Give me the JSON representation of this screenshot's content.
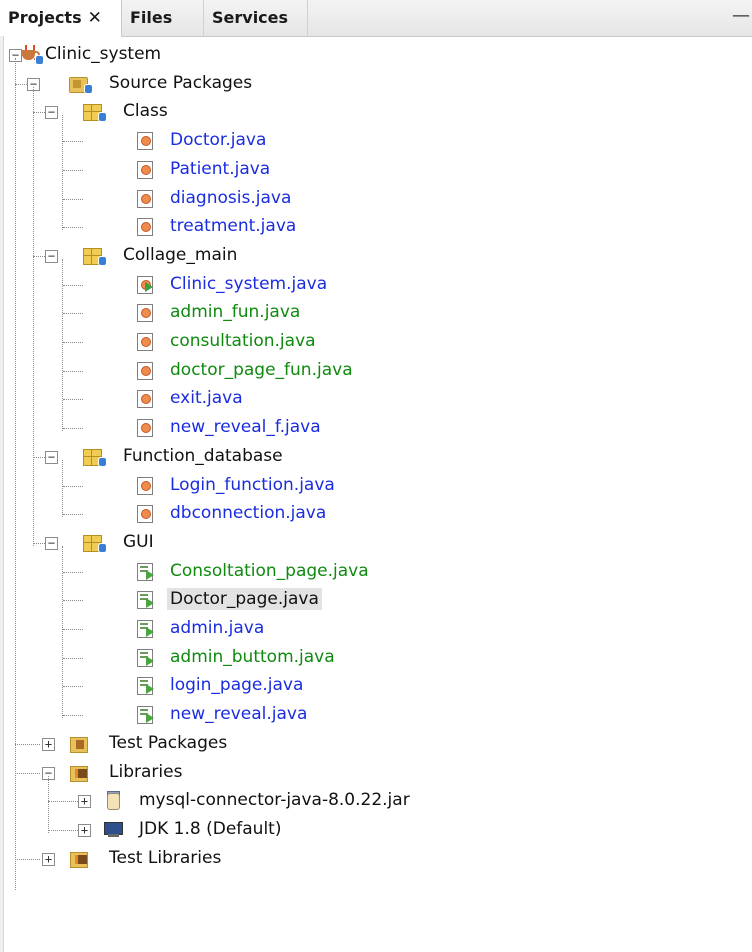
{
  "tabs": [
    {
      "label": "Projects",
      "close": "✕",
      "active": true
    },
    {
      "label": "Files"
    },
    {
      "label": "Services"
    }
  ],
  "window_control": "—",
  "tree": {
    "project": {
      "label": "Clinic_system",
      "icon": "coffee-cup-project-icon"
    },
    "source_packages": {
      "label": "Source Packages",
      "icon": "source-folder-icon"
    },
    "packages": [
      {
        "label": "Class",
        "files": [
          {
            "label": "Doctor.java",
            "color": "blue",
            "kind": "java"
          },
          {
            "label": "Patient.java",
            "color": "blue",
            "kind": "java"
          },
          {
            "label": "diagnosis.java",
            "color": "blue",
            "kind": "java"
          },
          {
            "label": "treatment.java",
            "color": "blue",
            "kind": "java"
          }
        ]
      },
      {
        "label": "Collage_main",
        "files": [
          {
            "label": "Clinic_system.java",
            "color": "blue",
            "kind": "main"
          },
          {
            "label": "admin_fun.java",
            "color": "green",
            "kind": "java"
          },
          {
            "label": "consultation.java",
            "color": "green",
            "kind": "java"
          },
          {
            "label": "doctor_page_fun.java",
            "color": "green",
            "kind": "java"
          },
          {
            "label": "exit.java",
            "color": "blue",
            "kind": "java"
          },
          {
            "label": "new_reveal_f.java",
            "color": "blue",
            "kind": "java"
          }
        ]
      },
      {
        "label": "Function_database",
        "files": [
          {
            "label": "Login_function.java",
            "color": "blue",
            "kind": "java"
          },
          {
            "label": "dbconnection.java",
            "color": "blue",
            "kind": "java"
          }
        ]
      },
      {
        "label": "GUI",
        "files": [
          {
            "label": "Consoltation_page.java",
            "color": "green",
            "kind": "form"
          },
          {
            "label": "Doctor_page.java",
            "color": "black",
            "kind": "form",
            "selected": true
          },
          {
            "label": "admin.java",
            "color": "blue",
            "kind": "form"
          },
          {
            "label": "admin_buttom.java",
            "color": "green",
            "kind": "form"
          },
          {
            "label": "login_page.java",
            "color": "blue",
            "kind": "form"
          },
          {
            "label": "new_reveal.java",
            "color": "blue",
            "kind": "form"
          }
        ]
      }
    ],
    "test_packages": {
      "label": "Test Packages"
    },
    "libraries": {
      "label": "Libraries",
      "items": [
        {
          "label": "mysql-connector-java-8.0.22.jar",
          "icon": "jar-icon"
        },
        {
          "label": "JDK 1.8 (Default)",
          "icon": "jdk-monitor-icon"
        }
      ]
    },
    "test_libraries": {
      "label": "Test Libraries"
    },
    "toggle_symbols": {
      "expanded": "−",
      "collapsed": "+"
    }
  }
}
